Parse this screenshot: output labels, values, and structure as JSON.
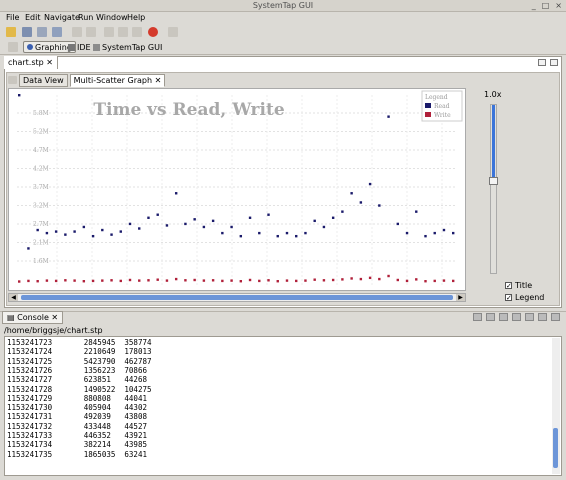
{
  "window": {
    "title": "SystemTap GUI"
  },
  "menu": [
    "File",
    "Edit",
    "Navigate",
    "Run",
    "Window",
    "Help"
  ],
  "perspectives": [
    {
      "label": "Graphing",
      "active": true
    },
    {
      "label": "IDE",
      "active": false
    },
    {
      "label": "SystemTap GUI",
      "active": false
    }
  ],
  "editor": {
    "tab": "chart.stp"
  },
  "subtabs": [
    "Data View",
    "Multi-Scatter Graph"
  ],
  "zoom": {
    "label": "1.0x",
    "level": 0.55
  },
  "options": {
    "title_label": "Title",
    "legend_label": "Legend",
    "title_checked": true,
    "legend_checked": true
  },
  "chart_data": {
    "type": "scatter",
    "title": "Time vs Read, Write",
    "legend": {
      "heading": "Legend",
      "placement": "top-right"
    },
    "yticks": [
      "5.8M",
      "5.2M",
      "4.7M",
      "4.2M",
      "3.7M",
      "3.2M",
      "2.7M",
      "2.1M",
      "1.6M"
    ],
    "ylim": [
      1500000,
      6000000
    ],
    "series": [
      {
        "name": "Read",
        "color": "#1a1a6a",
        "values": [
          6200000,
          1200000,
          1800000,
          1700000,
          1750000,
          1650000,
          1750000,
          1900000,
          1600000,
          1800000,
          1650000,
          1750000,
          2000000,
          1850000,
          2200000,
          2300000,
          1950000,
          3000000,
          2000000,
          2150000,
          1900000,
          2100000,
          1700000,
          1900000,
          1600000,
          2200000,
          1700000,
          2300000,
          1600000,
          1700000,
          1600000,
          1700000,
          2100000,
          1900000,
          2200000,
          2400000,
          3000000,
          2700000,
          3300000,
          2600000,
          5500000,
          2000000,
          1700000,
          2400000,
          1600000,
          1700000,
          1800000,
          1700000
        ]
      },
      {
        "name": "Write",
        "color": "#b0203a",
        "values": [
          120000,
          140000,
          130000,
          150000,
          140000,
          160000,
          150000,
          130000,
          140000,
          150000,
          160000,
          140000,
          170000,
          150000,
          160000,
          180000,
          150000,
          200000,
          160000,
          170000,
          150000,
          160000,
          140000,
          150000,
          130000,
          170000,
          140000,
          160000,
          130000,
          150000,
          140000,
          150000,
          180000,
          160000,
          170000,
          190000,
          220000,
          200000,
          240000,
          200000,
          300000,
          170000,
          140000,
          190000,
          130000,
          140000,
          150000,
          140000
        ]
      }
    ]
  },
  "console": {
    "tab": "Console",
    "path": "/home/briggsje/chart.stp",
    "rows": [
      [
        "1153241723",
        "2845945",
        "358774"
      ],
      [
        "1153241724",
        "2210649",
        "178013"
      ],
      [
        "1153241725",
        "5423790",
        "462787"
      ],
      [
        "1153241726",
        "1356223",
        "70866"
      ],
      [
        "1153241727",
        "623851",
        "44268"
      ],
      [
        "1153241728",
        "1490522",
        "104275"
      ],
      [
        "1153241729",
        "880808",
        "44041"
      ],
      [
        "1153241730",
        "405904",
        "44302"
      ],
      [
        "1153241731",
        "492039",
        "43808"
      ],
      [
        "1153241732",
        "433448",
        "44527"
      ],
      [
        "1153241733",
        "446352",
        "43921"
      ],
      [
        "1153241734",
        "382214",
        "43985"
      ],
      [
        "1153241735",
        "1865035",
        "63241"
      ]
    ]
  }
}
